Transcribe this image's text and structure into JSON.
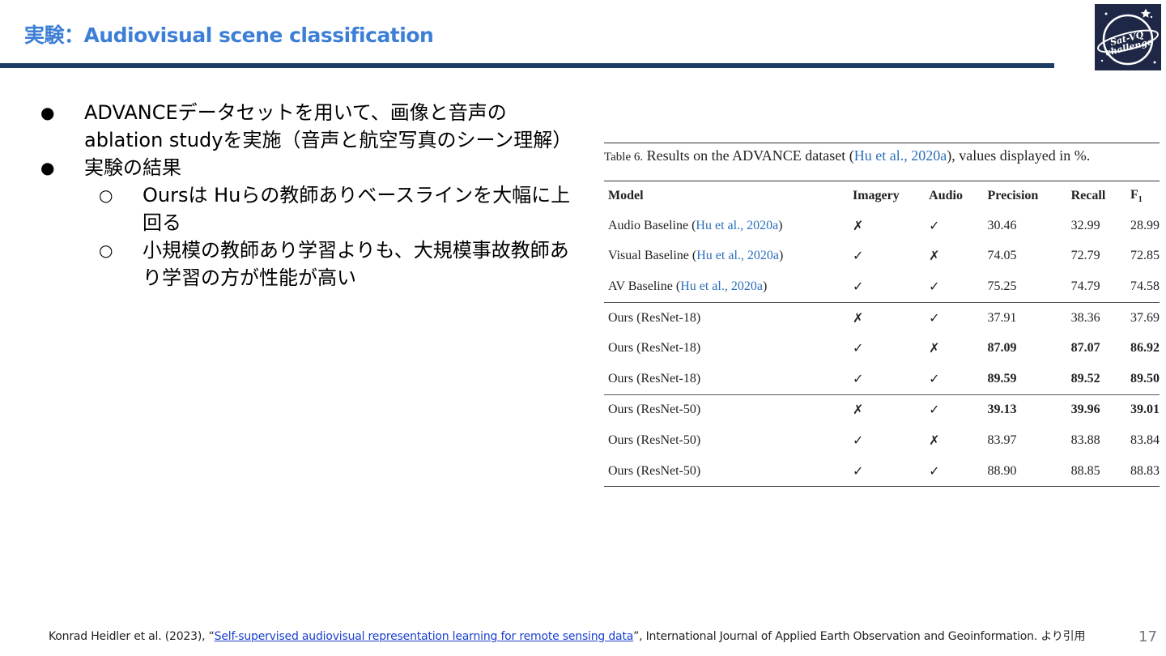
{
  "slide": {
    "title": "実験：Audiovisual scene classification",
    "page_number": "17"
  },
  "logo": {
    "text_line1": "Sat-VQ",
    "text_line2": "challenge",
    "background": "#1e2846"
  },
  "bullets": [
    {
      "text": "ADVANCEデータセットを用いて、画像と音声のablation studyを実施（音声と航空写真のシーン理解）"
    },
    {
      "text": "実験の結果",
      "sub": [
        "Oursは Huらの教師ありベースラインを大幅に上回る",
        "小規模の教師あり学習よりも、大規模事故教師あり学習の方が性能が高い"
      ]
    }
  ],
  "table": {
    "caption_label": "Table 6.",
    "caption_text": " Results on the ADVANCE dataset (",
    "caption_cite": "Hu et al., 2020a",
    "caption_tail": "), values displayed in %.",
    "headers": [
      "Model",
      "Imagery",
      "Audio",
      "Precision",
      "Recall",
      "F1"
    ],
    "rows": [
      {
        "model": "Audio Baseline (",
        "cite": "Hu et al., 2020a",
        "model_tail": ")",
        "imagery": "✗",
        "audio": "✓",
        "precision": "30.46",
        "recall": "32.99",
        "f1": "28.99"
      },
      {
        "model": "Visual Baseline (",
        "cite": "Hu et al., 2020a",
        "model_tail": ")",
        "imagery": "✓",
        "audio": "✗",
        "precision": "74.05",
        "recall": "72.79",
        "f1": "72.85"
      },
      {
        "model": "AV Baseline (",
        "cite": "Hu et al., 2020a",
        "model_tail": ")",
        "imagery": "✓",
        "audio": "✓",
        "precision": "75.25",
        "recall": "74.79",
        "f1": "74.58"
      },
      {
        "model": "Ours (ResNet-18)",
        "imagery": "✗",
        "audio": "✓",
        "precision": "37.91",
        "recall": "38.36",
        "f1": "37.69"
      },
      {
        "model": "Ours (ResNet-18)",
        "imagery": "✓",
        "audio": "✗",
        "precision": "87.09",
        "recall": "87.07",
        "f1": "86.92"
      },
      {
        "model": "Ours (ResNet-18)",
        "imagery": "✓",
        "audio": "✓",
        "precision": "89.59",
        "recall": "89.52",
        "f1": "89.50"
      },
      {
        "model": "Ours (ResNet-50)",
        "imagery": "✗",
        "audio": "✓",
        "precision": "39.13",
        "recall": "39.96",
        "f1": "39.01"
      },
      {
        "model": "Ours (ResNet-50)",
        "imagery": "✓",
        "audio": "✗",
        "precision": "83.97",
        "recall": "83.88",
        "f1": "83.84"
      },
      {
        "model": "Ours (ResNet-50)",
        "imagery": "✓",
        "audio": "✓",
        "precision": "88.90",
        "recall": "88.85",
        "f1": "88.83"
      }
    ]
  },
  "footer": {
    "prefix": "Konrad Heidler et al. (2023), “",
    "link_text": "Self-supervised audiovisual representation learning for remote sensing data",
    "suffix": "”, International Journal of Applied Earth Observation and Geoinformation. より引用"
  }
}
